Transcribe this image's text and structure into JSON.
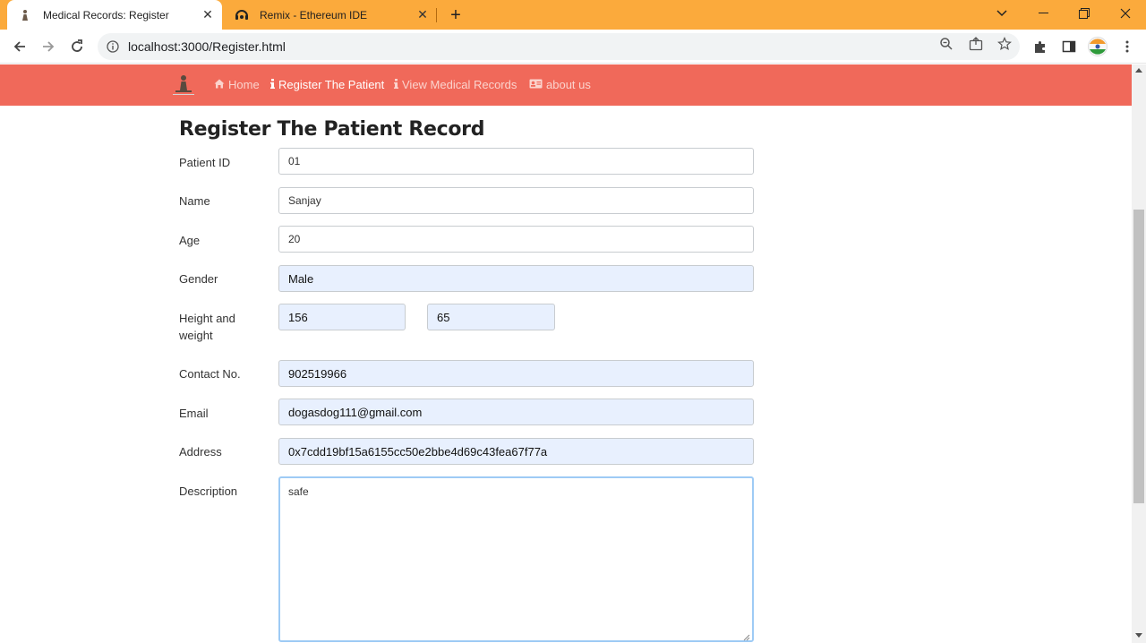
{
  "browser": {
    "tabs": [
      {
        "title": "Medical Records: Register",
        "icon": "person-icon",
        "active": true
      },
      {
        "title": "Remix - Ethereum IDE",
        "icon": "remix-icon",
        "active": false
      }
    ],
    "url": "localhost:3000/Register.html",
    "tab_strip_color": "#fbaa3c"
  },
  "navbar": {
    "color": "#f0695a",
    "links": [
      {
        "label": "Home",
        "icon": "home-icon"
      },
      {
        "label": "Register The Patient",
        "icon": "info-icon"
      },
      {
        "label": "View Medical Records",
        "icon": "info-icon"
      },
      {
        "label": "about us",
        "icon": "id-card-icon"
      }
    ]
  },
  "form": {
    "heading": "Register The Patient Record",
    "patient_id": {
      "label": "Patient ID",
      "value": "01"
    },
    "name": {
      "label": "Name",
      "value": "Sanjay"
    },
    "age": {
      "label": "Age",
      "value": "20"
    },
    "gender": {
      "label": "Gender",
      "value": "Male"
    },
    "height_weight": {
      "label_line1": "Height and",
      "label_line2": "weight",
      "height": "156",
      "weight": "65"
    },
    "contact": {
      "label": "Contact No.",
      "value": "902519966"
    },
    "email": {
      "label": "Email",
      "value": "dogasdog111@gmail.com"
    },
    "address": {
      "label": "Address",
      "value": "0x7cdd19bf15a6155cc50e2bbe4d69c43fea67f77a"
    },
    "description": {
      "label": "Description",
      "value": "safe"
    }
  }
}
